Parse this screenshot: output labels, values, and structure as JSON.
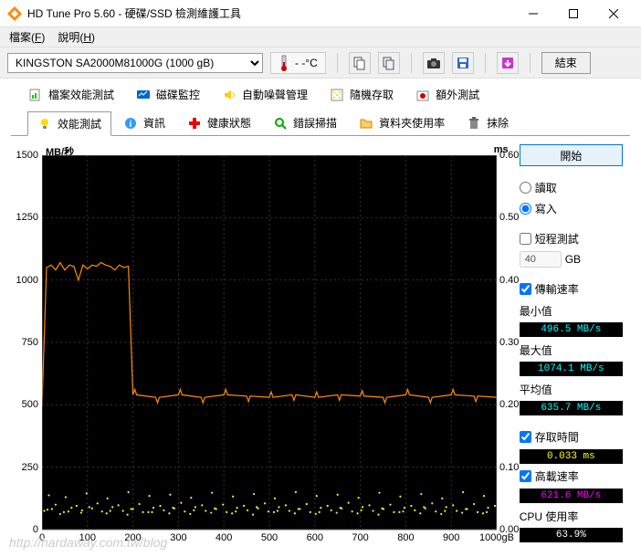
{
  "window": {
    "title": "HD Tune Pro 5.60 - 硬碟/SSD 檢測維護工具"
  },
  "menu": {
    "file": "檔案",
    "file_key": "F",
    "help": "說明",
    "help_key": "H"
  },
  "toolbar": {
    "drive": "KINGSTON SA2000M81000G (1000 gB)",
    "temp": "- -°C",
    "end": "結束"
  },
  "tabs": {
    "row1": {
      "file_perf": "檔案效能測試",
      "disk_monitor": "磁碟監控",
      "aam": "自動噪聲管理",
      "random_access": "隨機存取",
      "extra_tests": "額外測試"
    },
    "row2": {
      "benchmark": "效能測試",
      "info": "資訊",
      "health": "健康狀態",
      "error_scan": "錯誤掃描",
      "folder_usage": "資料夾使用率",
      "erase": "抹除"
    }
  },
  "controls": {
    "start": "開始",
    "read": "讀取",
    "write": "寫入",
    "short_test": "短程測試",
    "short_value": "40",
    "short_unit": "GB",
    "transfer_rate": "傳輸速率",
    "min_label": "最小值",
    "min_value": "496.5 MB/s",
    "max_label": "最大值",
    "max_value": "1074.1 MB/s",
    "avg_label": "平均值",
    "avg_value": "635.7 MB/s",
    "access_time": "存取時間",
    "access_value": "0.033 ms",
    "burst_rate": "高載速率",
    "burst_value": "621.6 MB/s",
    "cpu_label": "CPU 使用率",
    "cpu_value": "63.9%"
  },
  "chart_data": {
    "type": "line",
    "title": "",
    "ylabel_left": "MB/秒",
    "ylabel_right": "ms",
    "xlabel": "",
    "x_unit": "gB",
    "x_max_label": "1000gB",
    "ylim": [
      0,
      1500
    ],
    "yticks_left": [
      0,
      250,
      500,
      750,
      1000,
      1250,
      1500
    ],
    "yticks_right": [
      0.0,
      0.1,
      0.2,
      0.3,
      0.4,
      0.5,
      0.6
    ],
    "xticks": [
      0,
      100,
      200,
      300,
      400,
      500,
      600,
      700,
      800,
      900
    ],
    "x": [
      0,
      10,
      20,
      30,
      40,
      50,
      60,
      70,
      80,
      90,
      100,
      110,
      120,
      130,
      140,
      150,
      160,
      170,
      180,
      190,
      200,
      250,
      300,
      350,
      400,
      450,
      500,
      550,
      600,
      650,
      700,
      750,
      800,
      850,
      900,
      950,
      1000
    ],
    "transfer": [
      500,
      1050,
      1060,
      1040,
      1070,
      1040,
      1060,
      1055,
      1000,
      1060,
      1045,
      1060,
      1055,
      1070,
      1060,
      1055,
      1040,
      1060,
      1050,
      1055,
      540,
      530,
      540,
      530,
      540,
      535,
      530,
      540,
      530,
      540,
      535,
      530,
      540,
      530,
      540,
      535,
      530
    ],
    "access_scatter_x": [
      5,
      22,
      48,
      65,
      88,
      110,
      132,
      155,
      178,
      200,
      222,
      245,
      268,
      291,
      314,
      337,
      360,
      383,
      406,
      429,
      452,
      475,
      498,
      521,
      544,
      567,
      590,
      613,
      636,
      659,
      682,
      705,
      728,
      751,
      774,
      797,
      820,
      843,
      866,
      889,
      912,
      935,
      958,
      981,
      12,
      58,
      104,
      150,
      196,
      242,
      288,
      334,
      380,
      426,
      472,
      518,
      564,
      610,
      656,
      702,
      748,
      794,
      840,
      886,
      932,
      978,
      30,
      76,
      122,
      168,
      214,
      260,
      306,
      352,
      398,
      444,
      490,
      536,
      582,
      628,
      674,
      720,
      766,
      812,
      858,
      904,
      950,
      996,
      40,
      86,
      142,
      188,
      234,
      280,
      326,
      372,
      418,
      464,
      510,
      556,
      602,
      648,
      694,
      740,
      786,
      832,
      878,
      924,
      970,
      15,
      52,
      98,
      144,
      190,
      236,
      282,
      328,
      374,
      420,
      466,
      512,
      558,
      604,
      650,
      696,
      742,
      788,
      834,
      880,
      926,
      972
    ],
    "access_scatter_y": [
      0.03,
      0.033,
      0.028,
      0.035,
      0.031,
      0.034,
      0.029,
      0.036,
      0.03,
      0.033,
      0.028,
      0.035,
      0.031,
      0.034,
      0.029,
      0.036,
      0.03,
      0.033,
      0.028,
      0.035,
      0.031,
      0.034,
      0.029,
      0.036,
      0.03,
      0.033,
      0.028,
      0.035,
      0.031,
      0.034,
      0.029,
      0.036,
      0.03,
      0.033,
      0.028,
      0.035,
      0.031,
      0.034,
      0.029,
      0.036,
      0.03,
      0.033,
      0.028,
      0.035,
      0.032,
      0.029,
      0.036,
      0.03,
      0.033,
      0.028,
      0.035,
      0.031,
      0.034,
      0.029,
      0.036,
      0.03,
      0.033,
      0.028,
      0.035,
      0.031,
      0.034,
      0.029,
      0.036,
      0.03,
      0.033,
      0.028,
      0.04,
      0.038,
      0.042,
      0.039,
      0.041,
      0.038,
      0.043,
      0.039,
      0.04,
      0.038,
      0.042,
      0.039,
      0.041,
      0.038,
      0.043,
      0.039,
      0.04,
      0.038,
      0.042,
      0.039,
      0.041,
      0.038,
      0.025,
      0.027,
      0.026,
      0.024,
      0.028,
      0.026,
      0.025,
      0.027,
      0.026,
      0.024,
      0.028,
      0.026,
      0.025,
      0.027,
      0.026,
      0.024,
      0.028,
      0.026,
      0.025,
      0.027,
      0.026,
      0.055,
      0.052,
      0.058,
      0.05,
      0.06,
      0.054,
      0.056,
      0.051,
      0.059,
      0.053,
      0.057,
      0.05,
      0.06,
      0.054,
      0.056,
      0.051,
      0.059,
      0.053,
      0.057,
      0.05,
      0.06,
      0.054
    ]
  },
  "watermark": "http://hardaway.com.tw/blog"
}
